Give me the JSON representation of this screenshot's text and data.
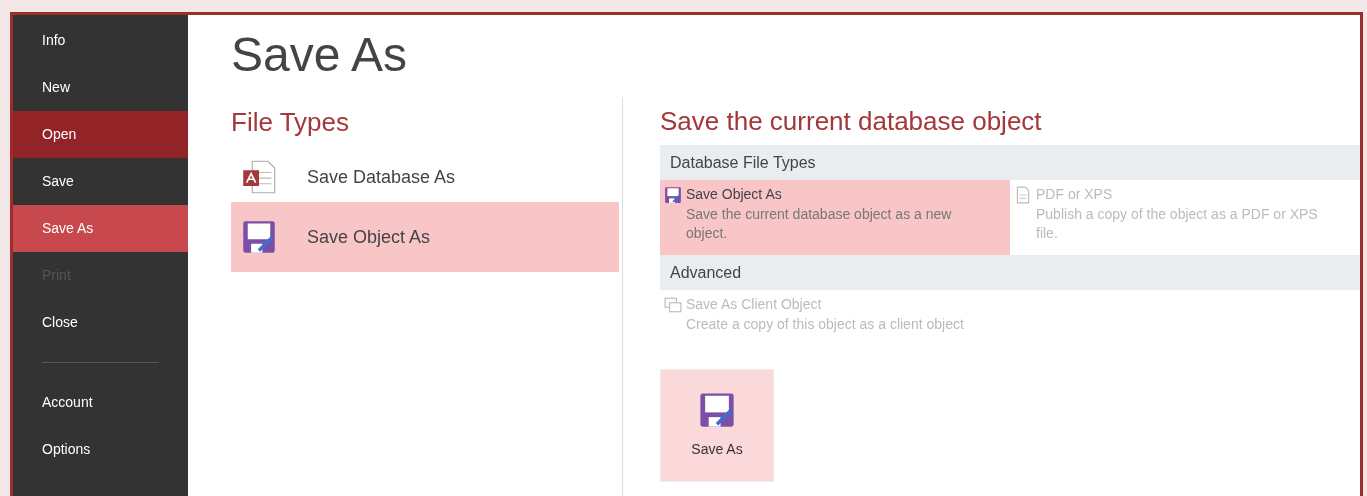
{
  "sidebar": {
    "items": [
      {
        "label": "Info",
        "selected": false,
        "hovered": false,
        "disabled": false
      },
      {
        "label": "New",
        "selected": false,
        "hovered": false,
        "disabled": false
      },
      {
        "label": "Open",
        "selected": false,
        "hovered": true,
        "disabled": false
      },
      {
        "label": "Save",
        "selected": false,
        "hovered": false,
        "disabled": false
      },
      {
        "label": "Save As",
        "selected": true,
        "hovered": false,
        "disabled": false
      },
      {
        "label": "Print",
        "selected": false,
        "hovered": false,
        "disabled": true
      },
      {
        "label": "Close",
        "selected": false,
        "hovered": false,
        "disabled": false
      }
    ],
    "footer_items": [
      {
        "label": "Account"
      },
      {
        "label": "Options"
      }
    ]
  },
  "page_title": "Save As",
  "file_types": {
    "heading": "File Types",
    "items": [
      {
        "label": "Save Database As",
        "kind": "database",
        "selected": false
      },
      {
        "label": "Save Object As",
        "kind": "object",
        "selected": true
      }
    ]
  },
  "details": {
    "heading": "Save the current database object",
    "groups": [
      {
        "title": "Database File Types",
        "options": [
          {
            "title": "Save Object As",
            "description": "Save the current database object as a new object.",
            "kind": "object",
            "selected": true,
            "disabled": false
          },
          {
            "title": "PDF or XPS",
            "description": "Publish a copy of the object as a PDF or XPS file.",
            "kind": "document",
            "selected": false,
            "disabled": true
          }
        ]
      },
      {
        "title": "Advanced",
        "options": [
          {
            "title": "Save As Client Object",
            "description": "Create a copy of this object as a client object",
            "kind": "client",
            "selected": false,
            "disabled": true
          }
        ]
      }
    ],
    "button": {
      "label": "Save As"
    }
  }
}
